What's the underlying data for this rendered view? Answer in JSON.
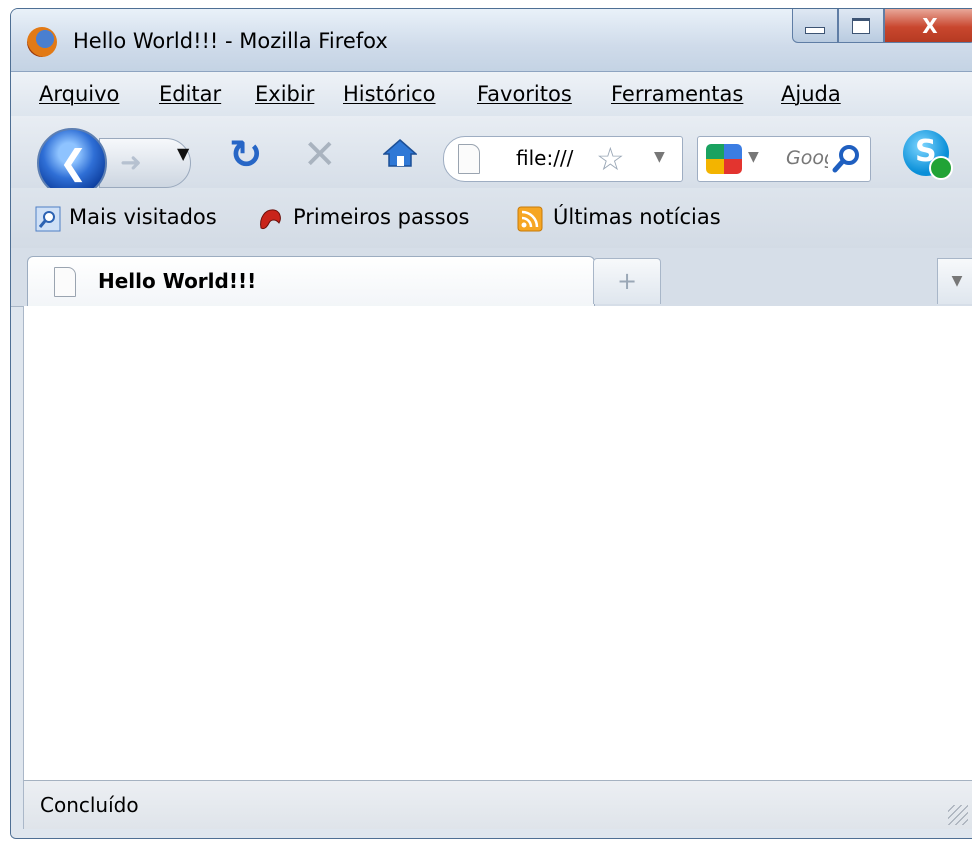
{
  "window": {
    "title": "Hello World!!! - Mozilla Firefox",
    "close_glyph": "X"
  },
  "menu": [
    {
      "label": "Arquivo"
    },
    {
      "label": "Editar"
    },
    {
      "label": "Exibir"
    },
    {
      "label": "Histórico"
    },
    {
      "label": "Favoritos"
    },
    {
      "label": "Ferramentas"
    },
    {
      "label": "Ajuda"
    }
  ],
  "navigation": {
    "url": "file:///",
    "search_placeholder": "Google"
  },
  "bookmarks": [
    {
      "label": "Mais visitados",
      "icon": "magnifier-bookmark-icon"
    },
    {
      "label": "Primeiros passos",
      "icon": "firefox-red-icon"
    },
    {
      "label": "Últimas notícias",
      "icon": "rss-feed-icon"
    }
  ],
  "tabs": [
    {
      "label": "Hello World!!!"
    }
  ],
  "status": {
    "text": "Concluído"
  },
  "colors": {
    "reload_blue": "#2766c6",
    "frame": "#dfe6ee",
    "close_red": "#c9472e"
  }
}
